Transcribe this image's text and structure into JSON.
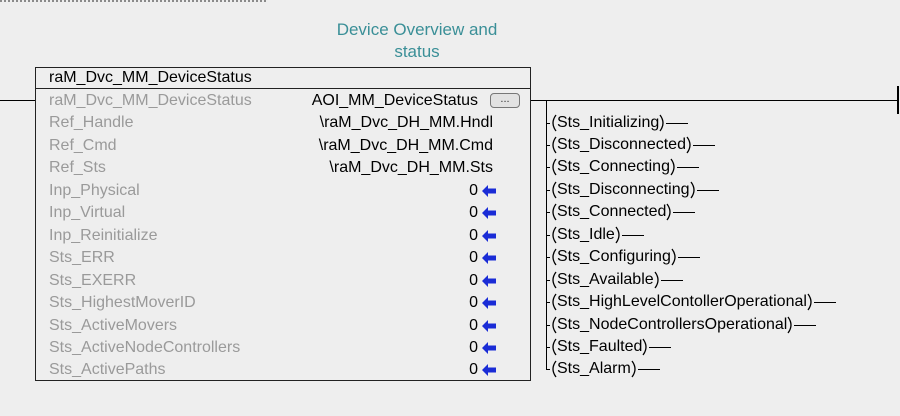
{
  "rung": {
    "title": "Device Overview and\nstatus"
  },
  "block": {
    "name": "raM_Dvc_MM_DeviceStatus",
    "rows": [
      {
        "label": "raM_Dvc_MM_DeviceStatus",
        "value": "AOI_MM_DeviceStatus",
        "kind": "aoi"
      },
      {
        "label": "Ref_Handle",
        "value": "\\raM_Dvc_DH_MM.Hndl",
        "kind": "ref"
      },
      {
        "label": "Ref_Cmd",
        "value": "\\raM_Dvc_DH_MM.Cmd",
        "kind": "ref"
      },
      {
        "label": "Ref_Sts",
        "value": "\\raM_Dvc_DH_MM.Sts",
        "kind": "ref"
      },
      {
        "label": "Inp_Physical",
        "value": "0",
        "kind": "num"
      },
      {
        "label": "Inp_Virtual",
        "value": "0",
        "kind": "num"
      },
      {
        "label": "Inp_Reinitialize",
        "value": "0",
        "kind": "num"
      },
      {
        "label": "Sts_ERR",
        "value": "0",
        "kind": "num"
      },
      {
        "label": "Sts_EXERR",
        "value": "0",
        "kind": "num"
      },
      {
        "label": "Sts_HighestMoverID",
        "value": "0",
        "kind": "num"
      },
      {
        "label": "Sts_ActiveMovers",
        "value": "0",
        "kind": "num"
      },
      {
        "label": "Sts_ActiveNodeControllers",
        "value": "0",
        "kind": "num"
      },
      {
        "label": "Sts_ActivePaths",
        "value": "0",
        "kind": "num"
      }
    ],
    "ellipsis_label": "...",
    "arrow_color": "#1a2cd6"
  },
  "coils": [
    "Sts_Initializing",
    "Sts_Disconnected",
    "Sts_Connecting",
    "Sts_Disconnecting",
    "Sts_Connected",
    "Sts_Idle",
    "Sts_Configuring",
    "Sts_Available",
    "Sts_HighLevelContollerOperational",
    "Sts_NodeControllersOperational",
    "Sts_Faulted",
    "Sts_Alarm"
  ],
  "colors": {
    "background": "#eeeeee",
    "title": "#3a8f97",
    "param_label": "#9a9a9a"
  }
}
